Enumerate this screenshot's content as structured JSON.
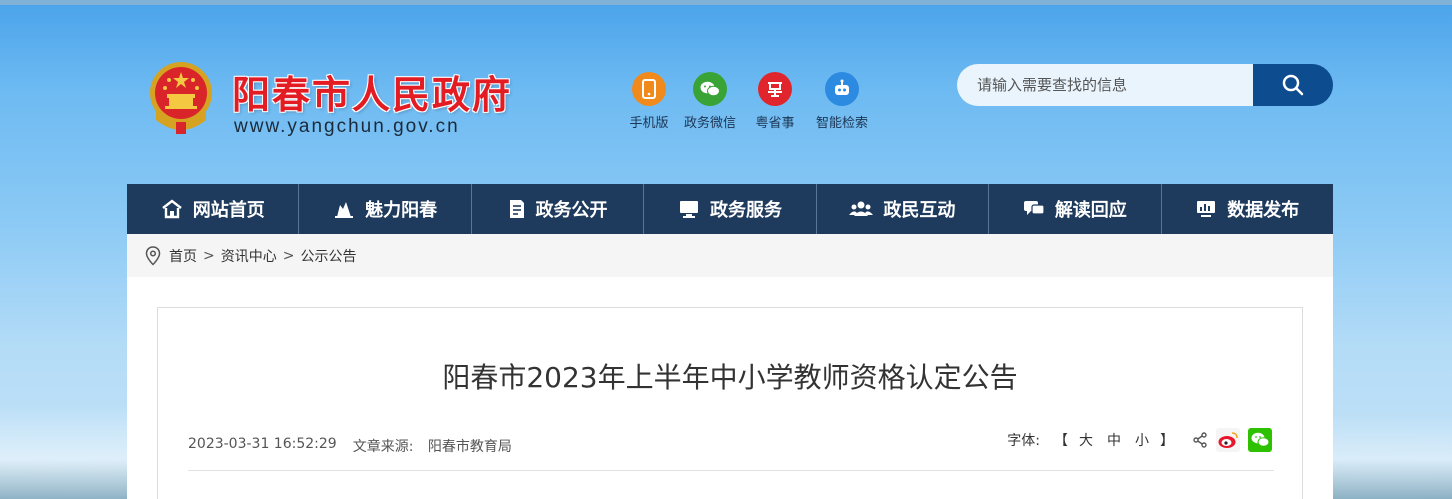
{
  "header": {
    "site_title": "阳春市人民政府",
    "site_url": "www.yangchun.gov.cn",
    "quick_links": [
      {
        "label": "手机版",
        "icon": "mobile-icon",
        "color": "#f08a1c"
      },
      {
        "label": "政务微信",
        "icon": "wechat-icon",
        "color": "#3aa336"
      },
      {
        "label": "粤省事",
        "icon": "yue-icon",
        "color": "#e0262c"
      },
      {
        "label": "智能检索",
        "icon": "robot-icon",
        "color": "#2c8ae0"
      }
    ],
    "search": {
      "placeholder": "请输入需要查找的信息"
    }
  },
  "nav": {
    "items": [
      {
        "label": "网站首页",
        "icon": "home-icon"
      },
      {
        "label": "魅力阳春",
        "icon": "landmark-icon"
      },
      {
        "label": "政务公开",
        "icon": "document-icon"
      },
      {
        "label": "政务服务",
        "icon": "monitor-icon"
      },
      {
        "label": "政民互动",
        "icon": "people-icon"
      },
      {
        "label": "解读回应",
        "icon": "chat-icon"
      },
      {
        "label": "数据发布",
        "icon": "data-icon"
      }
    ]
  },
  "breadcrumb": [
    "首页",
    "资讯中心",
    "公示公告"
  ],
  "article": {
    "title": "阳春市2023年上半年中小学教师资格认定公告",
    "datetime": "2023-03-31 16:52:29",
    "source_label": "文章来源:",
    "source": "阳春市教育局",
    "font_label": "字体:",
    "font_open": "【",
    "font_close": "】",
    "font_sizes": [
      "大",
      "中",
      "小"
    ]
  },
  "colors": {
    "nav_bg": "#1e3a5c",
    "title_red": "#e31b23",
    "search_btn": "#0c4c8f"
  }
}
